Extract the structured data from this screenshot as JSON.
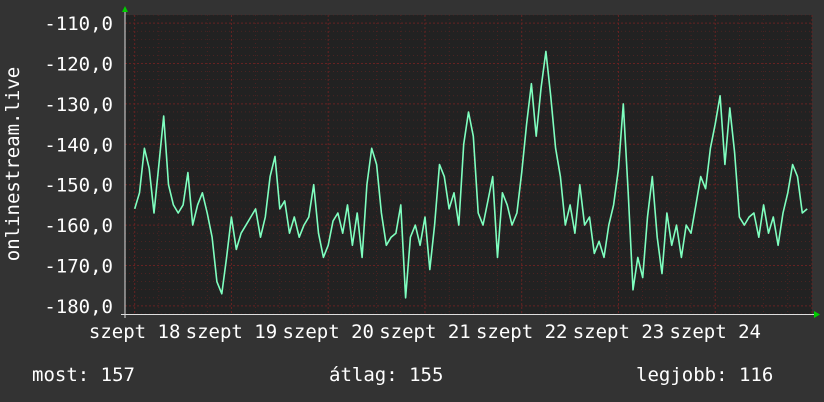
{
  "chart_data": {
    "type": "line",
    "ylabel": "onlinestream.live",
    "ylim": [
      -182,
      -108
    ],
    "yticks": [
      -110,
      -120,
      -130,
      -140,
      -150,
      -160,
      -170,
      -180
    ],
    "ytick_labels": [
      "-110,0",
      "-120,0",
      "-130,0",
      "-140,0",
      "-150,0",
      "-160,0",
      "-170,0",
      "-180,0"
    ],
    "xlim": [
      17.9,
      25.0
    ],
    "xticks": [
      18,
      19,
      20,
      21,
      22,
      23,
      24
    ],
    "xtick_labels": [
      "szept 18",
      "szept 19",
      "szept 20",
      "szept 21",
      "szept 22",
      "szept 23",
      "szept 24"
    ],
    "series": [
      {
        "color": "#7fffbf",
        "x": [
          18.0,
          18.05,
          18.1,
          18.15,
          18.2,
          18.25,
          18.3,
          18.35,
          18.4,
          18.45,
          18.5,
          18.55,
          18.6,
          18.65,
          18.7,
          18.75,
          18.8,
          18.85,
          18.9,
          18.95,
          19.0,
          19.05,
          19.1,
          19.15,
          19.2,
          19.25,
          19.3,
          19.35,
          19.4,
          19.45,
          19.5,
          19.55,
          19.6,
          19.65,
          19.7,
          19.75,
          19.8,
          19.85,
          19.9,
          19.95,
          20.0,
          20.05,
          20.1,
          20.15,
          20.2,
          20.25,
          20.3,
          20.35,
          20.4,
          20.45,
          20.5,
          20.55,
          20.6,
          20.65,
          20.7,
          20.75,
          20.8,
          20.85,
          20.9,
          20.95,
          21.0,
          21.05,
          21.1,
          21.15,
          21.2,
          21.25,
          21.3,
          21.35,
          21.4,
          21.45,
          21.5,
          21.55,
          21.6,
          21.65,
          21.7,
          21.75,
          21.8,
          21.85,
          21.9,
          21.95,
          22.0,
          22.05,
          22.1,
          22.15,
          22.2,
          22.25,
          22.3,
          22.35,
          22.4,
          22.45,
          22.5,
          22.55,
          22.6,
          22.65,
          22.7,
          22.75,
          22.8,
          22.85,
          22.9,
          22.95,
          23.0,
          23.05,
          23.1,
          23.15,
          23.2,
          23.25,
          23.3,
          23.35,
          23.4,
          23.45,
          23.5,
          23.55,
          23.6,
          23.65,
          23.7,
          23.75,
          23.8,
          23.85,
          23.9,
          23.95,
          24.0,
          24.05,
          24.1,
          24.15,
          24.2,
          24.25,
          24.3,
          24.35,
          24.4,
          24.45,
          24.5,
          24.55,
          24.6,
          24.65,
          24.7,
          24.75,
          24.8,
          24.85,
          24.9,
          24.95
        ],
        "values": [
          -156,
          -152,
          -141,
          -146,
          -157,
          -145,
          -133,
          -150,
          -155,
          -157,
          -155,
          -147,
          -160,
          -155,
          -152,
          -157,
          -163,
          -174,
          -177,
          -168,
          -158,
          -166,
          -162,
          -160,
          -158,
          -156,
          -163,
          -158,
          -148,
          -143,
          -156,
          -154,
          -162,
          -158,
          -163,
          -160,
          -158,
          -150,
          -162,
          -168,
          -165,
          -159,
          -157,
          -162,
          -155,
          -165,
          -157,
          -168,
          -150,
          -141,
          -145,
          -157,
          -165,
          -163,
          -162,
          -155,
          -178,
          -163,
          -160,
          -165,
          -158,
          -171,
          -160,
          -145,
          -148,
          -156,
          -152,
          -160,
          -140,
          -132,
          -138,
          -157,
          -160,
          -154,
          -148,
          -168,
          -152,
          -155,
          -160,
          -157,
          -147,
          -135,
          -125,
          -138,
          -126,
          -117,
          -128,
          -141,
          -148,
          -160,
          -155,
          -162,
          -150,
          -160,
          -158,
          -167,
          -164,
          -168,
          -160,
          -155,
          -146,
          -130,
          -152,
          -176,
          -168,
          -173,
          -158,
          -148,
          -163,
          -172,
          -157,
          -165,
          -160,
          -168,
          -160,
          -162,
          -155,
          -148,
          -151,
          -141,
          -135,
          -128,
          -145,
          -131,
          -142,
          -158,
          -160,
          -158,
          -157,
          -163,
          -155,
          -162,
          -158,
          -165,
          -157,
          -152,
          -145,
          -148,
          -157,
          -156
        ]
      }
    ],
    "stats": [
      {
        "label": "most: 157"
      },
      {
        "label": "átlag: 155"
      },
      {
        "label": "legjobb: 116"
      }
    ],
    "colors": {
      "background": "#333333",
      "plot_background": "#222222",
      "grid": "#662222",
      "line": "#7fffbf",
      "text": "#ffffff",
      "axis_arrow": "#00cc00"
    }
  }
}
